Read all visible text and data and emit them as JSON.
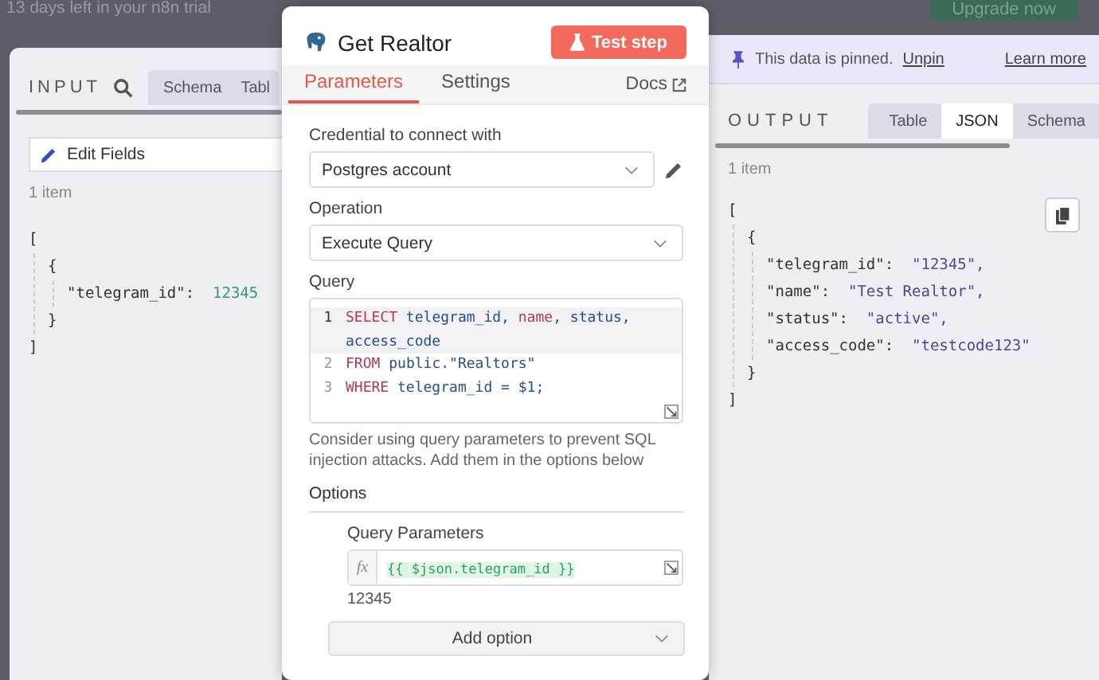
{
  "top_bar": {
    "trial_notice": "13 days left in your n8n trial",
    "upgrade_button": "Upgrade now"
  },
  "input_panel": {
    "title": "INPUT",
    "tabs": [
      {
        "label": "Schema",
        "selected": false
      },
      {
        "label": "Tabl",
        "selected": false
      }
    ],
    "source_node": "Edit Fields",
    "item_count": "1 item",
    "json": {
      "open": "[",
      "obj_open": "{",
      "entries": [
        {
          "key": "\"telegram_id\":",
          "value": "12345",
          "kind": "number"
        }
      ],
      "obj_close": "}",
      "close": "]"
    }
  },
  "node_panel": {
    "title": "Get Realtor",
    "test_button": "Test step",
    "tabs": [
      {
        "label": "Parameters",
        "selected": true
      },
      {
        "label": "Settings",
        "selected": false
      }
    ],
    "docs_link": "Docs",
    "credential": {
      "label": "Credential to connect with",
      "value": "Postgres account"
    },
    "operation": {
      "label": "Operation",
      "value": "Execute Query"
    },
    "query": {
      "label": "Query",
      "lines": [
        {
          "number": "1",
          "active": true,
          "tokens": [
            {
              "text": "SELECT",
              "kind": "keyword"
            },
            {
              "text": " telegram_id, ",
              "kind": "ident"
            },
            {
              "text": "name",
              "kind": "keyword"
            },
            {
              "text": ", status, access_code",
              "kind": "ident"
            }
          ]
        },
        {
          "number": "2",
          "active": false,
          "tokens": [
            {
              "text": "FROM",
              "kind": "keyword"
            },
            {
              "text": " public.\"Realtors\"",
              "kind": "ident"
            }
          ]
        },
        {
          "number": "3",
          "active": false,
          "tokens": [
            {
              "text": "WHERE",
              "kind": "keyword"
            },
            {
              "text": " telegram_id = $1;",
              "kind": "ident"
            }
          ]
        }
      ]
    },
    "hint": "Consider using query parameters to prevent SQL injection attacks. Add them in the options below",
    "options_title": "Options",
    "query_parameters": {
      "label": "Query Parameters",
      "fx": "fx",
      "expression": "{{ $json.telegram_id }}",
      "result": "12345"
    },
    "add_option": "Add option"
  },
  "output_panel": {
    "pinned_notice": "This data is pinned.",
    "unpin_link": "Unpin",
    "learn_more_link": "Learn more",
    "title": "OUTPUT",
    "tabs": [
      {
        "label": "Table",
        "selected": false
      },
      {
        "label": "JSON",
        "selected": true
      },
      {
        "label": "Schema",
        "selected": false
      }
    ],
    "item_count": "1 item",
    "json": {
      "open": "[",
      "obj_open": "{",
      "entries": [
        {
          "key": "\"telegram_id\":",
          "value": "\"12345\",",
          "kind": "string"
        },
        {
          "key": "\"name\":",
          "value": "\"Test Realtor\",",
          "kind": "string"
        },
        {
          "key": "\"status\":",
          "value": "\"active\",",
          "kind": "string"
        },
        {
          "key": "\"access_code\":",
          "value": "\"testcode123\"",
          "kind": "string"
        }
      ],
      "obj_close": "}",
      "close": "]"
    }
  }
}
